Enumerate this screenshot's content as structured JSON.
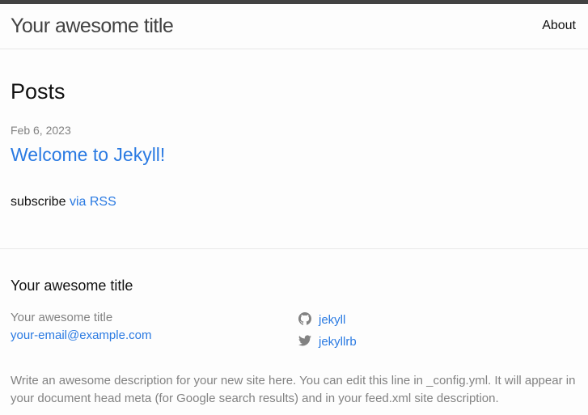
{
  "header": {
    "site_title": "Your awesome title",
    "nav": [
      {
        "label": "About"
      }
    ]
  },
  "main": {
    "heading": "Posts",
    "posts": [
      {
        "date": "Feb 6, 2023",
        "title": "Welcome to Jekyll!"
      }
    ],
    "rss": {
      "prefix": "subscribe",
      "link_label": "via RSS"
    }
  },
  "footer": {
    "heading": "Your awesome title",
    "name": "Your awesome title",
    "email": "your-email@example.com",
    "social": [
      {
        "icon": "github-icon",
        "label": "jekyll"
      },
      {
        "icon": "twitter-icon",
        "label": "jekyllrb"
      }
    ],
    "description": "Write an awesome description for your new site here. You can edit this line in _config.yml. It will appear in your document head meta (for Google search results) and in your feed.xml site description."
  },
  "colors": {
    "link": "#2a7ae2",
    "muted": "#828282",
    "text": "#111111",
    "top_bar": "#424242",
    "background": "#fdfdfd"
  }
}
